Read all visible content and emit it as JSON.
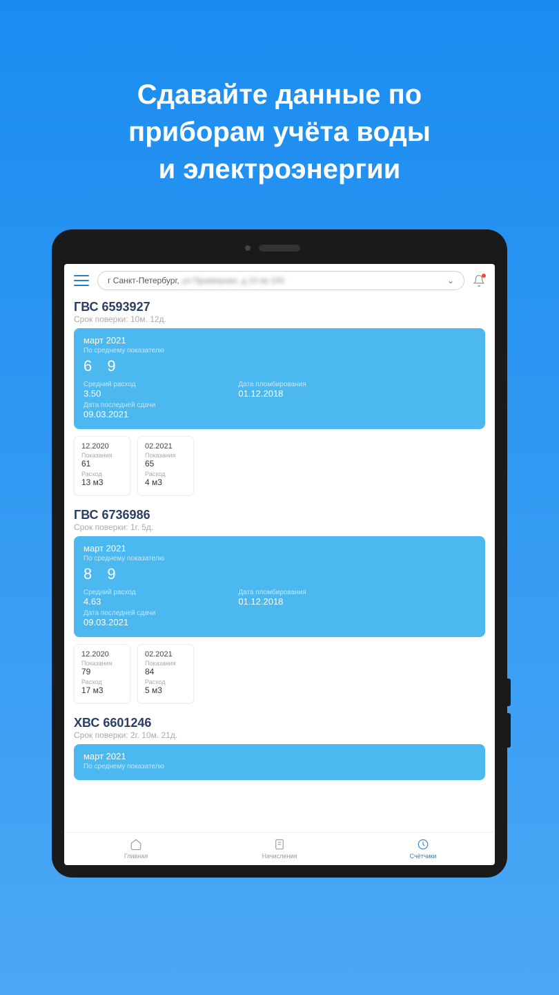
{
  "promo": {
    "line1": "Сдавайте данные по",
    "line2": "приборам учёта воды",
    "line3": "и электроэнергии"
  },
  "header": {
    "address_prefix": "г Санкт-Петербург,",
    "address_rest": "ул Примерная, д 10 кв 100"
  },
  "meters": [
    {
      "title": "ГВС 6593927",
      "verify": "Срок поверки: 10м. 12д.",
      "current": {
        "month": "март 2021",
        "avg_label": "По среднему показателю",
        "reading": "6 9",
        "avg_cons_label": "Средний расход",
        "avg_cons": "3.50",
        "last_date_label": "Дата последней сдачи",
        "last_date": "09.03.2021",
        "seal_label": "Дата пломбирования",
        "seal_date": "01.12.2018"
      },
      "history": [
        {
          "date": "12.2020",
          "read_label": "Показания",
          "read": "61",
          "cons_label": "Расход",
          "cons": "13 м3"
        },
        {
          "date": "02.2021",
          "read_label": "Показания",
          "read": "65",
          "cons_label": "Расход",
          "cons": "4 м3"
        }
      ]
    },
    {
      "title": "ГВС 6736986",
      "verify": "Срок поверки: 1г. 5д.",
      "current": {
        "month": "март 2021",
        "avg_label": "По среднему показателю",
        "reading": "8 9",
        "avg_cons_label": "Средний расход",
        "avg_cons": "4.63",
        "last_date_label": "Дата последней сдачи",
        "last_date": "09.03.2021",
        "seal_label": "Дата пломбирования",
        "seal_date": "01.12.2018"
      },
      "history": [
        {
          "date": "12.2020",
          "read_label": "Показания",
          "read": "79",
          "cons_label": "Расход",
          "cons": "17 м3"
        },
        {
          "date": "02.2021",
          "read_label": "Показания",
          "read": "84",
          "cons_label": "Расход",
          "cons": "5 м3"
        }
      ]
    },
    {
      "title": "ХВС 6601246",
      "verify": "Срок поверки: 2г. 10м. 21д.",
      "current": {
        "month": "март 2021",
        "avg_label": "По среднему показателю",
        "reading": "",
        "avg_cons_label": "",
        "avg_cons": "",
        "last_date_label": "",
        "last_date": "",
        "seal_label": "",
        "seal_date": ""
      },
      "history": []
    }
  ],
  "nav": {
    "home": "Главная",
    "charges": "Начисления",
    "meters": "Счётчики"
  }
}
